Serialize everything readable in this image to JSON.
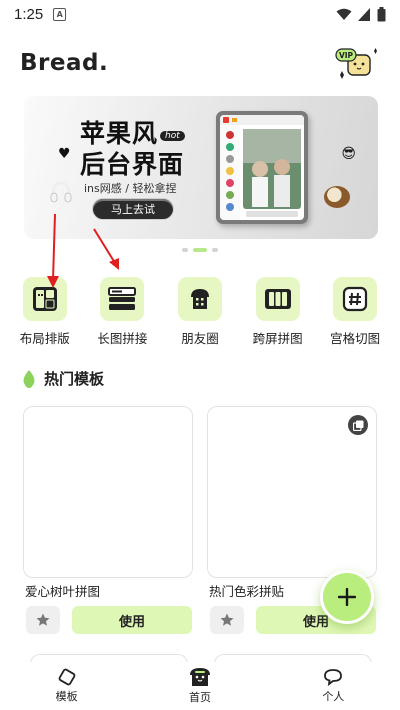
{
  "status_bar": {
    "time": "1:25",
    "notification_icon": "a-icon"
  },
  "header": {
    "brand": "Bread.",
    "vip_label": "VIP"
  },
  "banner": {
    "title_line1": "苹果风",
    "hot_tag": "hot",
    "title_line2": "后台界面",
    "subtitle": "ins网感 / 轻松拿捏",
    "cta": "马上去试",
    "page_indicator": {
      "count": 3,
      "active": 2
    }
  },
  "tools": [
    {
      "label": "布局排版",
      "icon": "layout-icon"
    },
    {
      "label": "长图拼接",
      "icon": "long-image-icon"
    },
    {
      "label": "朋友圈",
      "icon": "bread-icon"
    },
    {
      "label": "跨屏拼图",
      "icon": "cross-screen-icon"
    },
    {
      "label": "宫格切图",
      "icon": "grid-cut-icon"
    }
  ],
  "section": {
    "title": "热门模板"
  },
  "templates": [
    {
      "name": "爱心树叶拼图",
      "use_label": "使用"
    },
    {
      "name": "热门色彩拼贴",
      "use_label": "使用"
    }
  ],
  "bottom_nav": [
    {
      "label": "模板",
      "icon": "template-icon"
    },
    {
      "label": "首页",
      "icon": "home-bread-icon",
      "active": true
    },
    {
      "label": "个人",
      "icon": "chat-bubble-icon"
    }
  ],
  "colors": {
    "accent": "#b9ed7e",
    "tool_bg": "#e7f7c4",
    "use_bg": "#dff7b4",
    "annotation": "#e02020"
  }
}
